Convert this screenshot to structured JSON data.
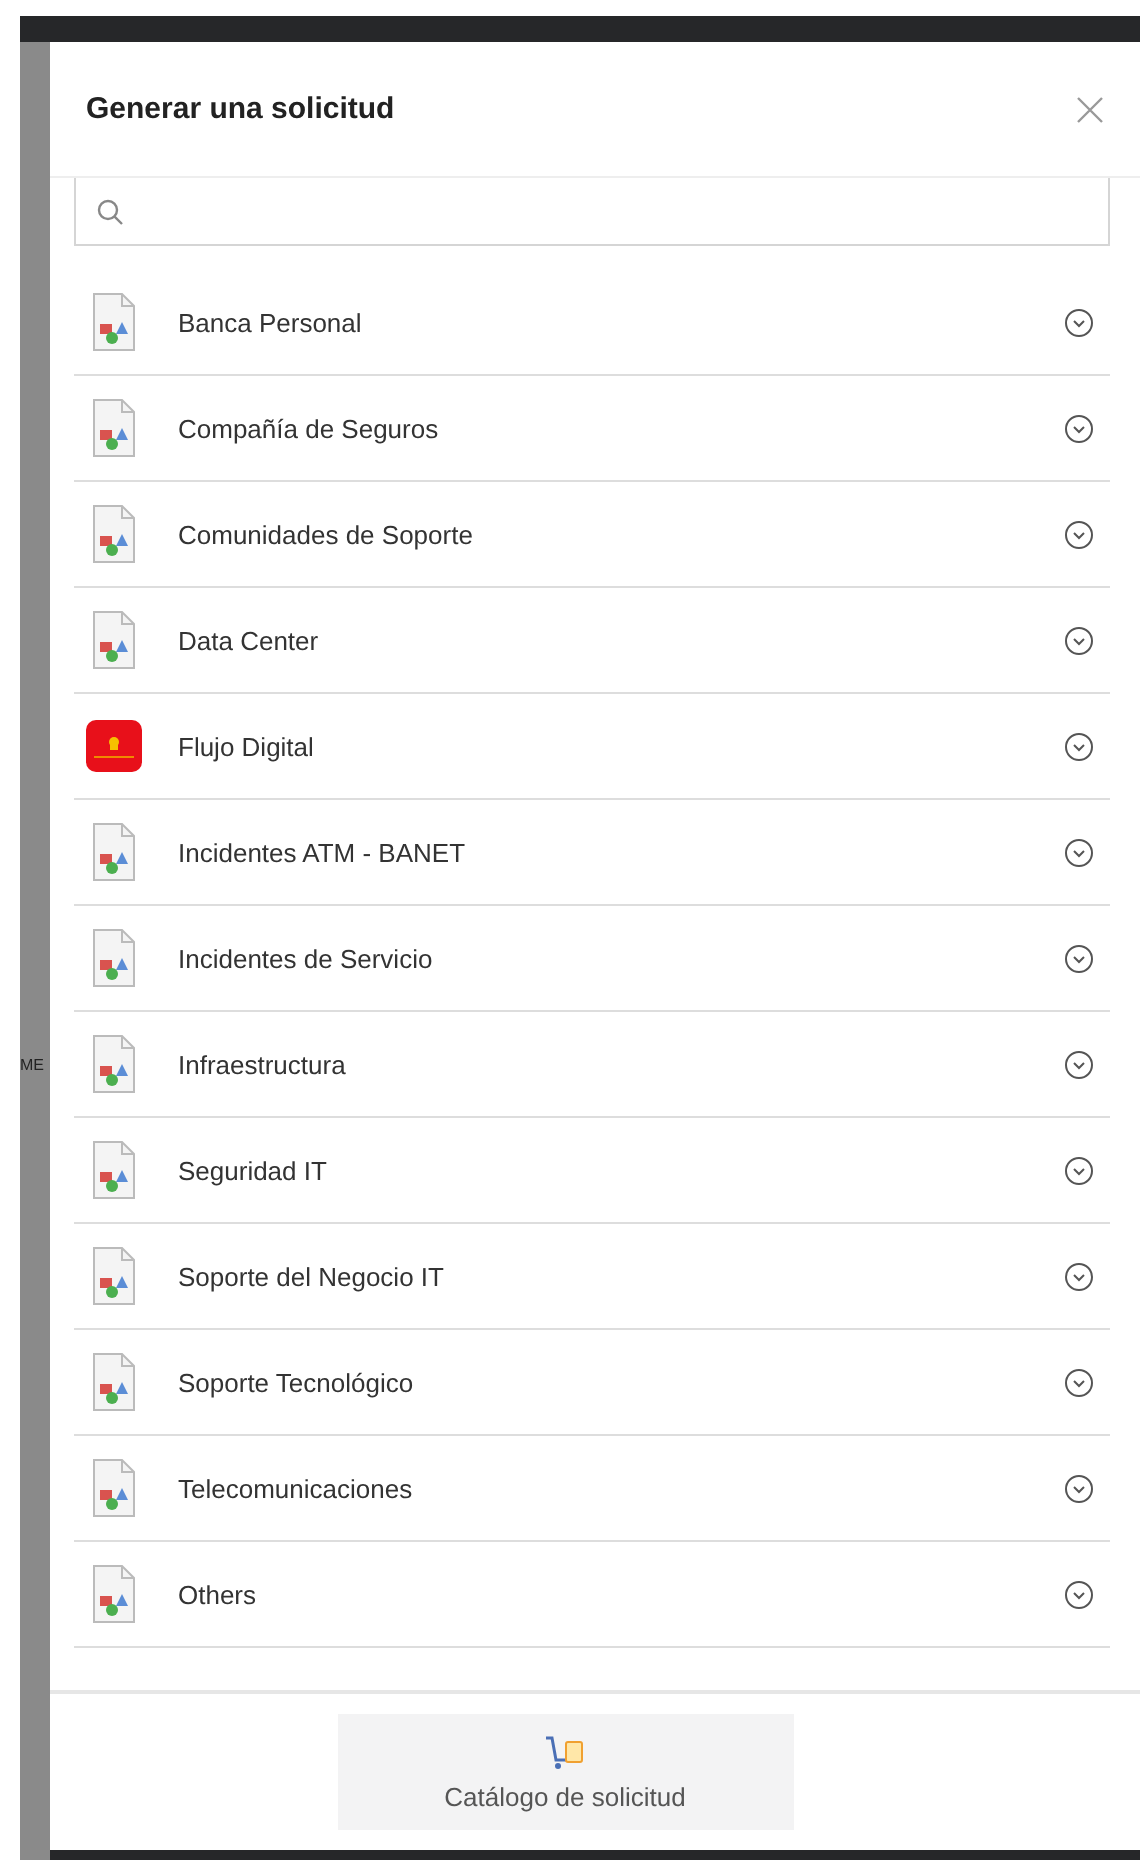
{
  "background": {
    "side_text": "ME"
  },
  "dialog": {
    "title": "Generar una solicitud"
  },
  "items": [
    {
      "label": "Banca Personal",
      "kind": "generic"
    },
    {
      "label": "Compañía de Seguros",
      "kind": "generic"
    },
    {
      "label": "Comunidades de Soporte",
      "kind": "generic"
    },
    {
      "label": "Data Center",
      "kind": "generic"
    },
    {
      "label": "Flujo Digital",
      "kind": "app"
    },
    {
      "label": "Incidentes ATM - BANET",
      "kind": "generic"
    },
    {
      "label": "Incidentes de Servicio",
      "kind": "generic"
    },
    {
      "label": "Infraestructura",
      "kind": "generic"
    },
    {
      "label": "Seguridad IT",
      "kind": "generic"
    },
    {
      "label": "Soporte del Negocio IT",
      "kind": "generic"
    },
    {
      "label": "Soporte Tecnológico",
      "kind": "generic"
    },
    {
      "label": "Telecomunicaciones",
      "kind": "generic"
    },
    {
      "label": "Others",
      "kind": "generic"
    }
  ],
  "footer_button": {
    "label": "Catálogo de solicitud"
  }
}
